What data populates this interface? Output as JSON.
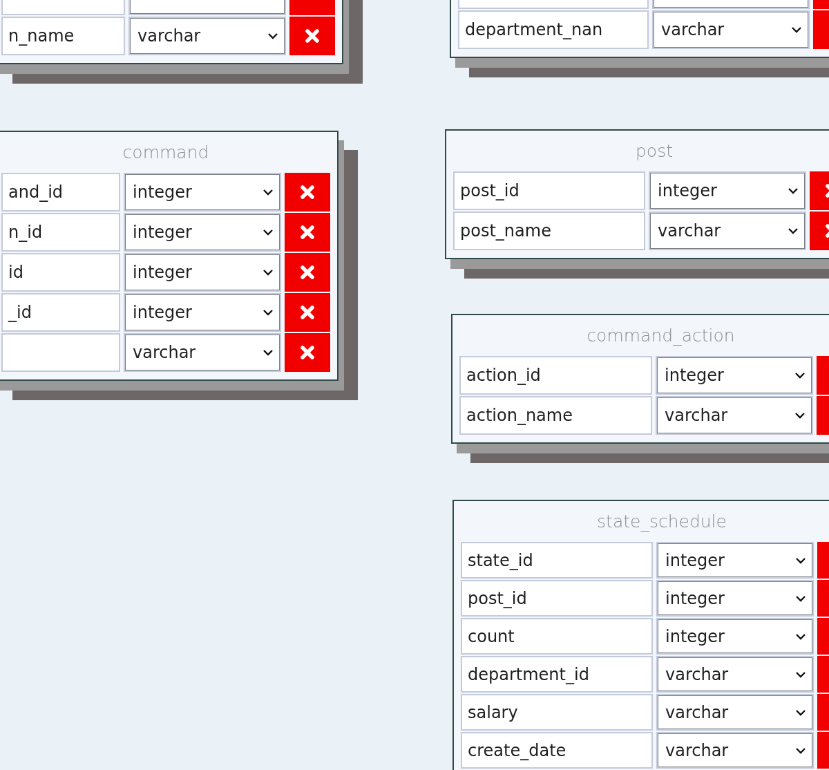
{
  "tables": [
    {
      "rows": [
        {
          "kind": "clipped"
        },
        {
          "kind": "column",
          "name": "n_name",
          "type": "varchar"
        }
      ]
    },
    {
      "rows": [
        {
          "kind": "clipped"
        },
        {
          "kind": "column",
          "name": "department_nan",
          "type": "varchar"
        }
      ]
    },
    {
      "title": "command",
      "rows": [
        {
          "kind": "column",
          "name": "and_id",
          "type": "integer"
        },
        {
          "kind": "column",
          "name": "n_id",
          "type": "integer"
        },
        {
          "kind": "column",
          "name": "id",
          "type": "integer"
        },
        {
          "kind": "column",
          "name": "_id",
          "type": "integer"
        },
        {
          "kind": "column",
          "type": "varchar"
        }
      ]
    },
    {
      "title": "post",
      "rows": [
        {
          "kind": "column",
          "name": "post_id",
          "type": "integer"
        },
        {
          "kind": "column",
          "name": "post_name",
          "type": "varchar"
        }
      ]
    },
    {
      "title": "command_action",
      "rows": [
        {
          "kind": "column",
          "name": "action_id",
          "type": "integer"
        },
        {
          "kind": "column",
          "name": "action_name",
          "type": "varchar"
        }
      ]
    },
    {
      "title": "state_schedule",
      "rows": [
        {
          "kind": "column",
          "name": "state_id",
          "type": "integer"
        },
        {
          "kind": "column",
          "name": "post_id",
          "type": "integer"
        },
        {
          "kind": "column",
          "name": "count",
          "type": "integer"
        },
        {
          "kind": "column",
          "name": "department_id",
          "type": "varchar"
        },
        {
          "kind": "column",
          "name": "salary",
          "type": "varchar"
        },
        {
          "kind": "column",
          "name": "create_date",
          "type": "varchar"
        }
      ]
    }
  ]
}
